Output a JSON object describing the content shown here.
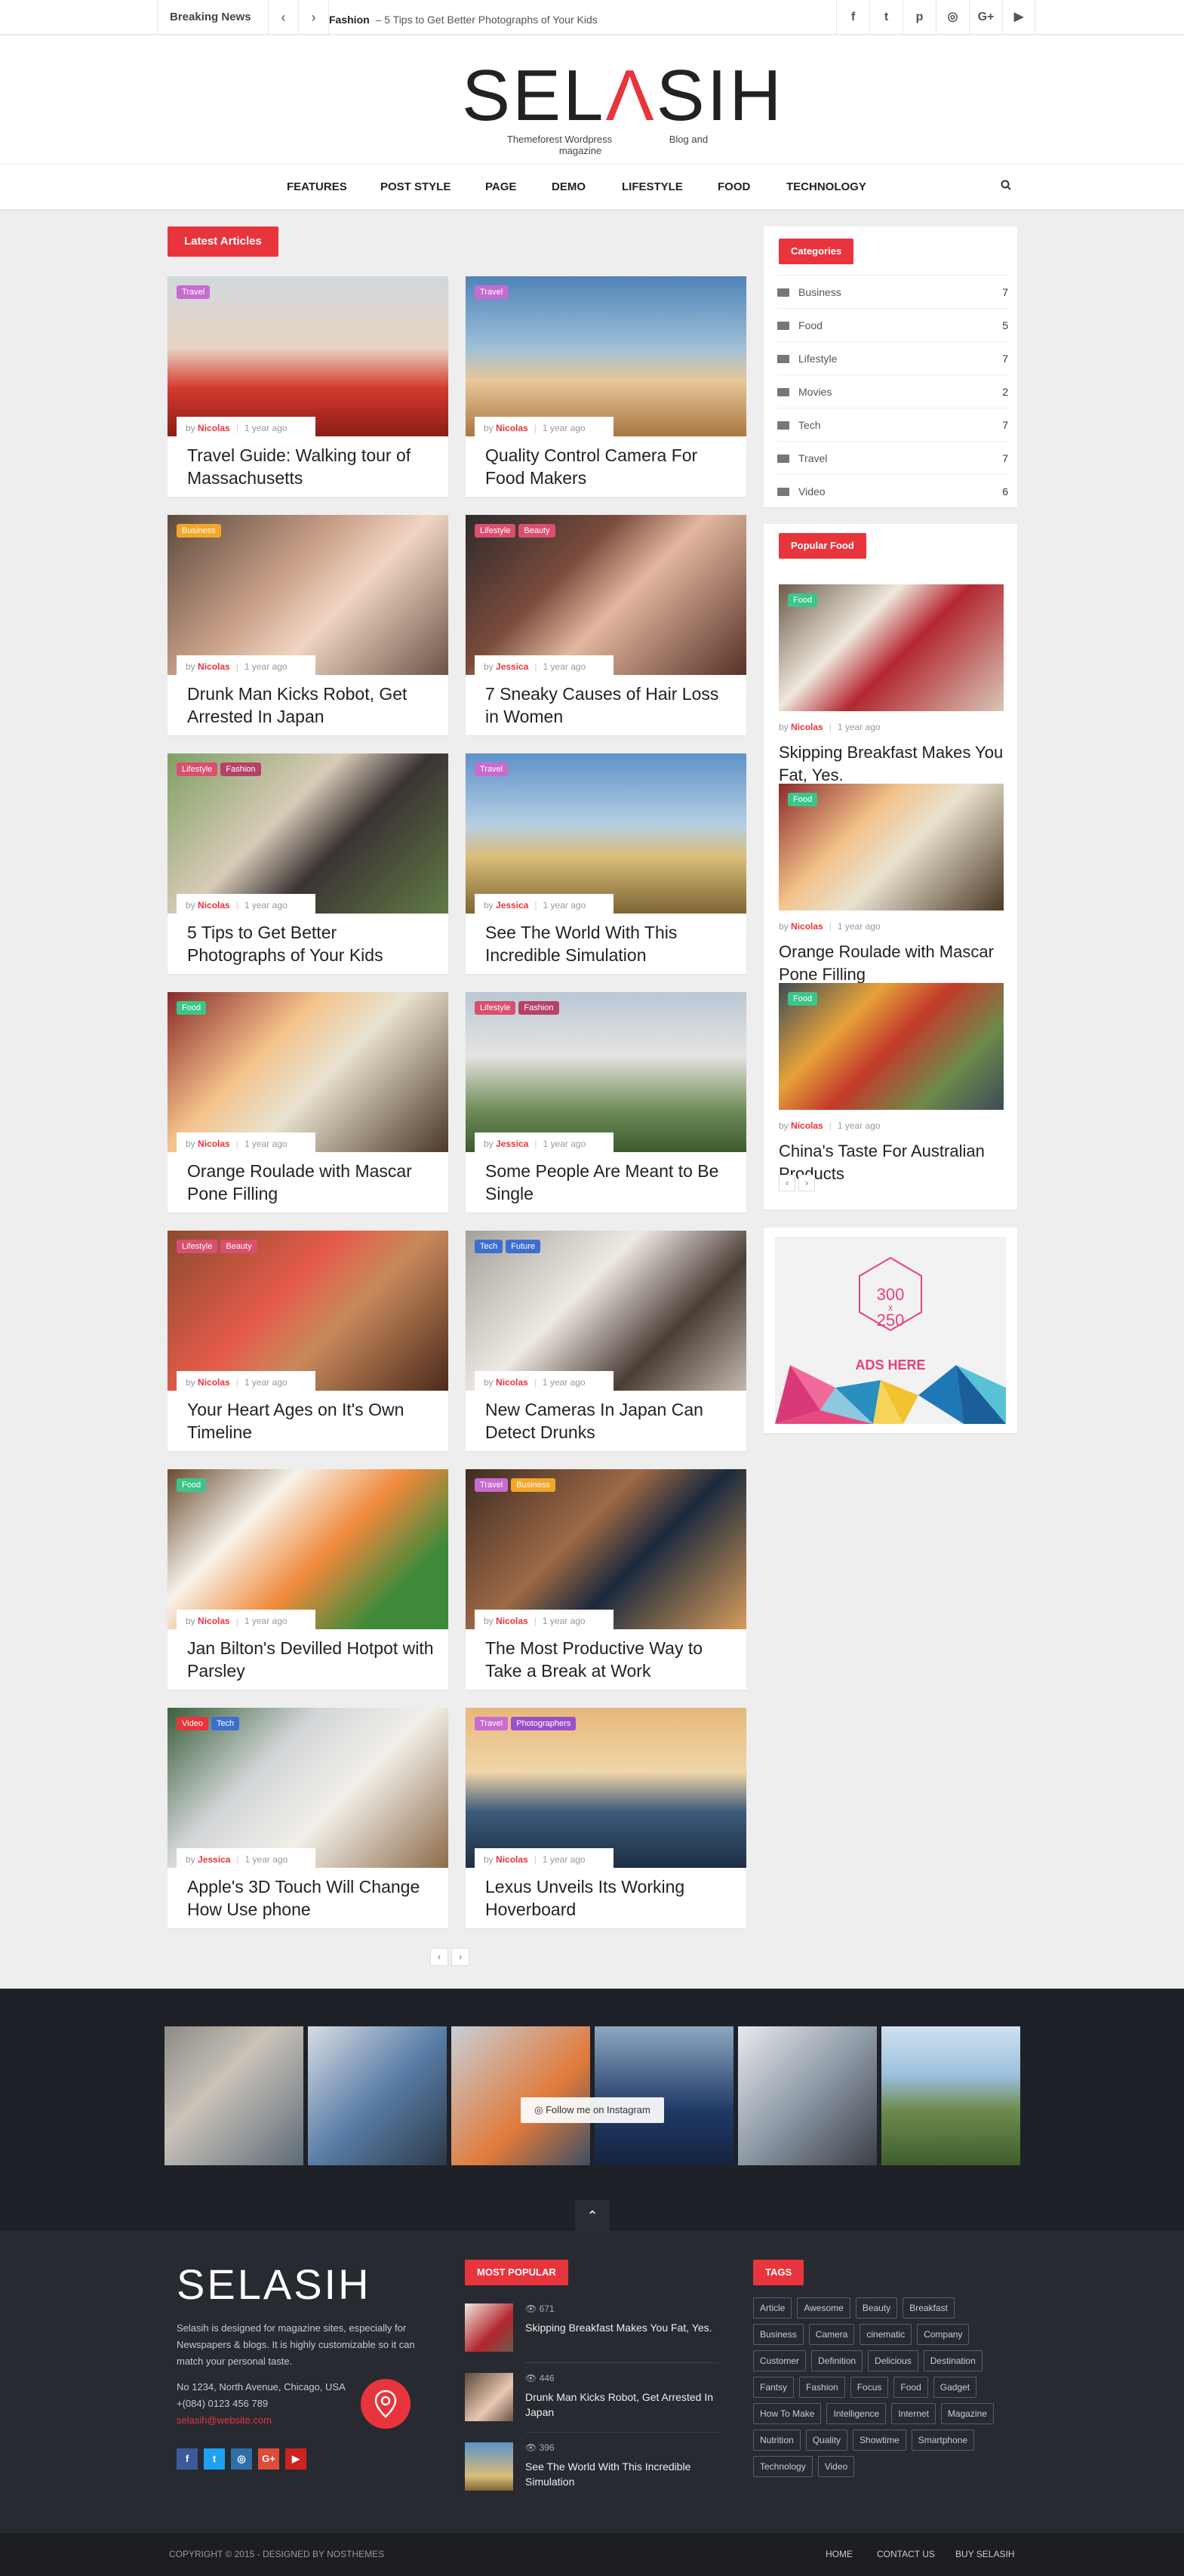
{
  "topbar": {
    "breaking_label": "Breaking News",
    "prev": "‹",
    "next": "›",
    "ticker_category": "Fashion",
    "ticker_text": "– 5 Tips to Get Better Photographs of Your Kids",
    "socials": [
      "f",
      "t",
      "p",
      "◎",
      "G+",
      "▶"
    ]
  },
  "logo": {
    "text_a": "SEL",
    "text_accent": "Λ",
    "text_b": "SIH",
    "sub_left": "Themeforest Wordpress",
    "sub_right": "Blog and magazine"
  },
  "nav": {
    "items": [
      "FEATURES",
      "POST STYLE",
      "PAGE",
      "DEMO",
      "LIFESTYLE",
      "FOOD",
      "TECHNOLOGY"
    ],
    "search_icon": "search-icon"
  },
  "latest_label": "Latest Articles",
  "articles": [
    {
      "tags": [
        {
          "t": "Travel",
          "c": "#c86bd0"
        }
      ],
      "by": "by",
      "author": "Nicolas",
      "time": "1 year ago",
      "title": "Travel Guide: Walking tour of Massachusetts"
    },
    {
      "tags": [
        {
          "t": "Travel",
          "c": "#c86bd0"
        }
      ],
      "by": "by",
      "author": "Nicolas",
      "time": "1 year ago",
      "title": "Quality Control Camera For Food Makers"
    },
    {
      "tags": [
        {
          "t": "Business",
          "c": "#f2a72a"
        }
      ],
      "by": "by",
      "author": "Nicolas",
      "time": "1 year ago",
      "title": "Drunk Man Kicks Robot, Get Arrested In Japan"
    },
    {
      "tags": [
        {
          "t": "Lifestyle",
          "c": "#d94f6f"
        },
        {
          "t": "Beauty",
          "c": "#d94f6f"
        }
      ],
      "by": "by",
      "author": "Jessica",
      "time": "1 year ago",
      "title": "7 Sneaky Causes of Hair Loss in Women"
    },
    {
      "tags": [
        {
          "t": "Lifestyle",
          "c": "#d94f6f"
        },
        {
          "t": "Fashion",
          "c": "#b5426b"
        }
      ],
      "by": "by",
      "author": "Nicolas",
      "time": "1 year ago",
      "title": "5 Tips to Get Better Photographs of Your Kids"
    },
    {
      "tags": [
        {
          "t": "Travel",
          "c": "#c86bd0"
        }
      ],
      "by": "by",
      "author": "Jessica",
      "time": "1 year ago",
      "title": "See The World With This Incredible Simulation"
    },
    {
      "tags": [
        {
          "t": "Food",
          "c": "#3cc58a"
        }
      ],
      "by": "by",
      "author": "Nicolas",
      "time": "1 year ago",
      "title": "Orange Roulade with Mascar Pone Filling"
    },
    {
      "tags": [
        {
          "t": "Lifestyle",
          "c": "#d94f6f"
        },
        {
          "t": "Fashion",
          "c": "#b5426b"
        }
      ],
      "by": "by",
      "author": "Jessica",
      "time": "1 year ago",
      "title": "Some People Are Meant to Be Single"
    },
    {
      "tags": [
        {
          "t": "Lifestyle",
          "c": "#d94f6f"
        },
        {
          "t": "Beauty",
          "c": "#d94f6f"
        }
      ],
      "by": "by",
      "author": "Nicolas",
      "time": "1 year ago",
      "title": "Your Heart Ages on It's Own Timeline"
    },
    {
      "tags": [
        {
          "t": "Tech",
          "c": "#3d6fd1"
        },
        {
          "t": "Future",
          "c": "#3d6fd1"
        }
      ],
      "by": "by",
      "author": "Nicolas",
      "time": "1 year ago",
      "title": "New Cameras In Japan Can Detect Drunks"
    },
    {
      "tags": [
        {
          "t": "Food",
          "c": "#3cc58a"
        }
      ],
      "by": "by",
      "author": "Nicolas",
      "time": "1 year ago",
      "title": "Jan Bilton's Devilled Hotpot with Parsley"
    },
    {
      "tags": [
        {
          "t": "Travel",
          "c": "#c86bd0"
        },
        {
          "t": "Business",
          "c": "#f2a72a"
        }
      ],
      "by": "by",
      "author": "Nicolas",
      "time": "1 year ago",
      "title": "The Most Productive Way to Take a Break at Work"
    },
    {
      "tags": [
        {
          "t": "Video",
          "c": "#e8343c"
        },
        {
          "t": "Tech",
          "c": "#3d6fd1"
        }
      ],
      "by": "by",
      "author": "Jessica",
      "time": "1 year ago",
      "title": "Apple's 3D Touch Will Change How Use phone"
    },
    {
      "tags": [
        {
          "t": "Travel",
          "c": "#c86bd0"
        },
        {
          "t": "Photographers",
          "c": "#9b4fc9"
        }
      ],
      "by": "by",
      "author": "Nicolas",
      "time": "1 year ago",
      "title": "Lexus Unveils Its Working Hoverboard"
    }
  ],
  "pager": {
    "prev": "‹",
    "next": "›"
  },
  "categories": {
    "label": "Categories",
    "items": [
      {
        "name": "Business",
        "count": "7"
      },
      {
        "name": "Food",
        "count": "5"
      },
      {
        "name": "Lifestyle",
        "count": "7"
      },
      {
        "name": "Movies",
        "count": "2"
      },
      {
        "name": "Tech",
        "count": "7"
      },
      {
        "name": "Travel",
        "count": "7"
      },
      {
        "name": "Video",
        "count": "6"
      }
    ]
  },
  "popular_food": {
    "label": "Popular Food",
    "items": [
      {
        "tag": "Food",
        "by": "by",
        "author": "Nicolas",
        "time": "1 year ago",
        "title": "Skipping Breakfast Makes You Fat, Yes."
      },
      {
        "tag": "Food",
        "by": "by",
        "author": "Nicolas",
        "time": "1 year ago",
        "title": "Orange Roulade with Mascar Pone Filling"
      },
      {
        "tag": "Food",
        "by": "by",
        "author": "Nicolas",
        "time": "1 year ago",
        "title": "China's Taste For Australian Products"
      }
    ]
  },
  "ad": {
    "size_a": "300",
    "size_x": "x",
    "size_b": "250",
    "text": "ADS HERE"
  },
  "instagram": {
    "follow": "Follow me on Instagram"
  },
  "totop": "⌃",
  "footer": {
    "logo": "SELASIH",
    "desc": "Selasih is designed for magazine sites, especially for Newspapers & blogs. It is highly customizable so it can match your personal taste.",
    "addr1": "No 1234, North Avenue, Chicago, USA",
    "phone": "+(084) 0123 456 789",
    "email": "selasih@website.com",
    "socials": [
      "f",
      "t",
      "◎",
      "G+",
      "▶"
    ],
    "most_popular_label": "MOST POPULAR",
    "most_popular": [
      {
        "views": "671",
        "title": "Skipping Breakfast Makes You Fat, Yes."
      },
      {
        "views": "446",
        "title": "Drunk Man Kicks Robot, Get Arrested In Japan"
      },
      {
        "views": "396",
        "title": "See The World With This Incredible Simulation"
      }
    ],
    "tags_label": "TAGS",
    "tags": [
      "Article",
      "Awesome",
      "Beauty",
      "Breakfast",
      "Business",
      "Camera",
      "cinematic",
      "Company",
      "Customer",
      "Definition",
      "Delicious",
      "Destination",
      "Fantsy",
      "Fashion",
      "Focus",
      "Food",
      "Gadget",
      "How To Make",
      "Intelligence",
      "Internet",
      "Magazine",
      "Nutrition",
      "Quality",
      "Showtime",
      "Smartphone",
      "Technology",
      "Video"
    ]
  },
  "bottombar": {
    "copyright": "COPYRIGHT © 2015 - DESIGNED BY NOSTHEMES",
    "links": [
      "HOME",
      "CONTACT US",
      "BUY SELASIH"
    ]
  }
}
